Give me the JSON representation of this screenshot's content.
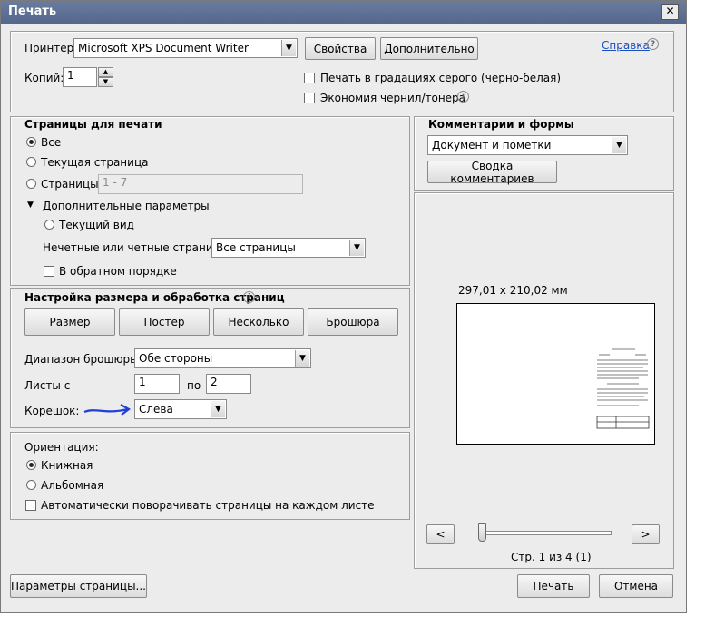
{
  "window": {
    "title": "Печать",
    "close_symbol": "✕"
  },
  "printer": {
    "label": "Принтер:",
    "value": "Microsoft XPS Document Writer",
    "properties_button": "Свойства",
    "advanced_button": "Дополнительно",
    "help_link": "Справка",
    "copies_label": "Копий:",
    "copies_value": "1",
    "grayscale_label": "Печать в градациях серого (черно-белая)",
    "save_ink_label": "Экономия чернил/тонера"
  },
  "pages": {
    "title": "Страницы для печати",
    "all": "Все",
    "current": "Текущая страница",
    "range": "Страницы",
    "range_value": "1 - 7",
    "more_options": "Дополнительные параметры",
    "current_view": "Текущий вид",
    "odd_even_label": "Нечетные или четные страницы:",
    "odd_even_value": "Все страницы",
    "reverse": "В обратном порядке"
  },
  "sizing": {
    "title": "Настройка размера и обработка страниц",
    "tabs": [
      "Размер",
      "Постер",
      "Несколько",
      "Брошюра"
    ],
    "booklet_range_label": "Диапазон брошюры:",
    "booklet_range_value": "Обе стороны",
    "sheets_label": "Листы с",
    "sheets_from": "1",
    "sheets_to_label": "по",
    "sheets_to": "2",
    "binding_label": "Корешок:",
    "binding_value": "Слева"
  },
  "orientation": {
    "title": "Ориентация:",
    "portrait": "Книжная",
    "landscape": "Альбомная",
    "auto_rotate": "Автоматически поворачивать страницы на каждом листе"
  },
  "comments": {
    "title": "Комментарии и формы",
    "value": "Документ и пометки",
    "summary_button": "Сводка комментариев"
  },
  "preview": {
    "page_size": "297,01 x 210,02 мм",
    "prev": "<",
    "next": ">",
    "page_counter": "Стр. 1 из 4 (1)"
  },
  "footer": {
    "page_setup": "Параметры страницы...",
    "print": "Печать",
    "cancel": "Отмена"
  },
  "colors": {
    "accent_link": "#1a4fbf",
    "annotation_arrow": "#1f3fd6"
  }
}
